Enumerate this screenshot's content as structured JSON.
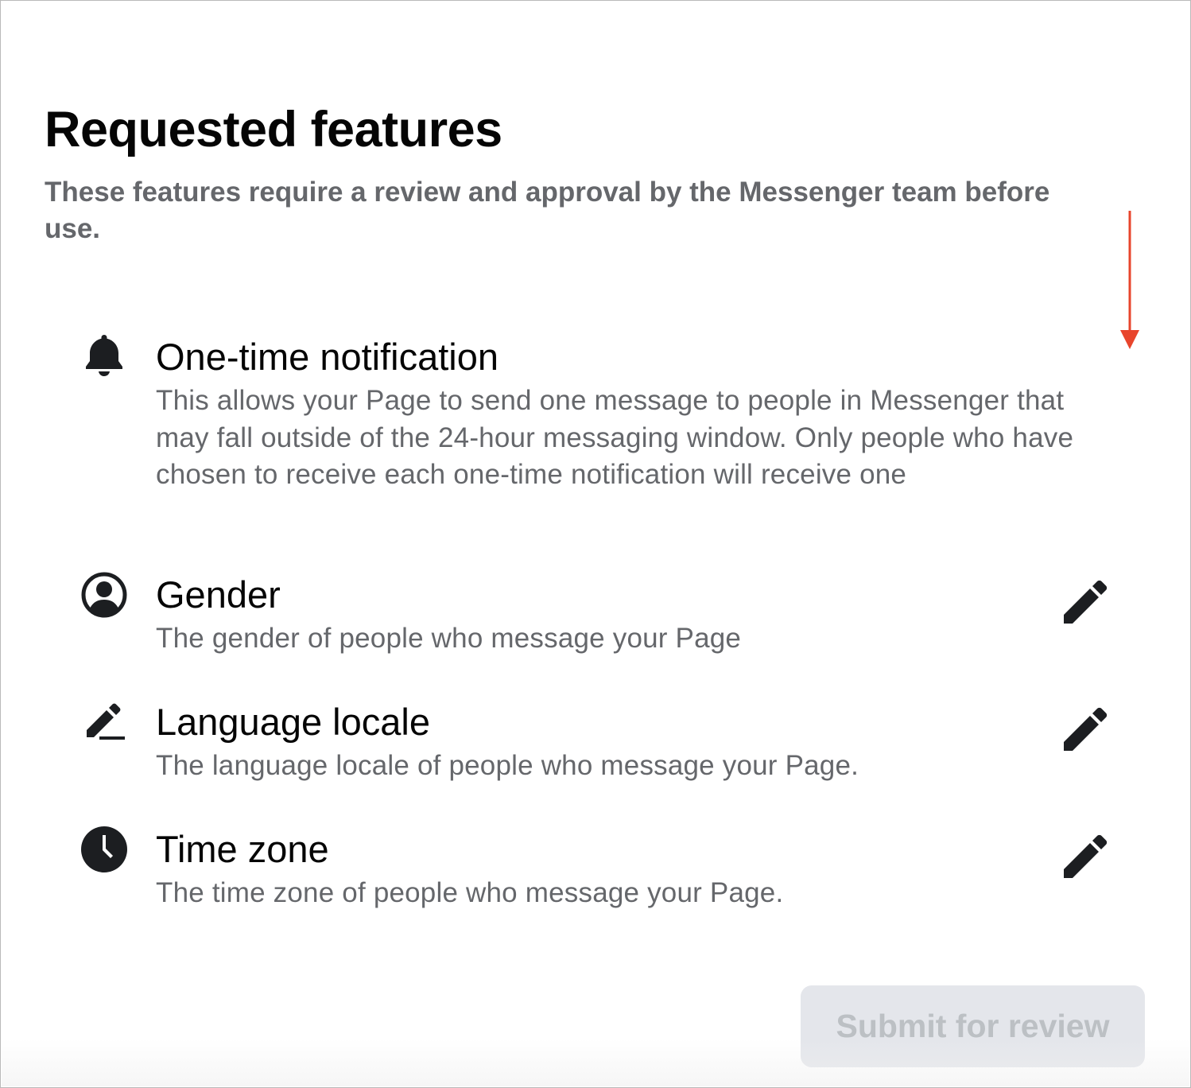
{
  "header": {
    "title": "Requested features",
    "subtitle": "These features require a review and approval by the Messenger team before use."
  },
  "annotation": {
    "color": "#e8452c",
    "icon": "down-arrow-icon"
  },
  "features": [
    {
      "icon": "bell-icon",
      "name": "One-time notification",
      "description": "This allows your Page to send one message to people in Messenger that may fall outside of the 24-hour messaging window. Only people who have chosen to receive each one-time notification will receive one",
      "editable": false
    },
    {
      "icon": "user-circle-icon",
      "name": "Gender",
      "description": "The gender of people who message your Page",
      "editable": true,
      "edit_icon": "pencil-icon"
    },
    {
      "icon": "pencil-line-icon",
      "name": "Language locale",
      "description": "The language locale of people who message your Page.",
      "editable": true,
      "edit_icon": "pencil-icon"
    },
    {
      "icon": "clock-icon",
      "name": "Time zone",
      "description": "The time zone of people who message your Page.",
      "editable": true,
      "edit_icon": "pencil-icon"
    }
  ],
  "footer": {
    "submit_label": "Submit for review",
    "submit_disabled": true
  },
  "colors": {
    "text_primary": "#050505",
    "text_secondary": "#65676b",
    "button_disabled_bg": "#e4e6eb",
    "button_disabled_text": "#bcc0c4"
  }
}
